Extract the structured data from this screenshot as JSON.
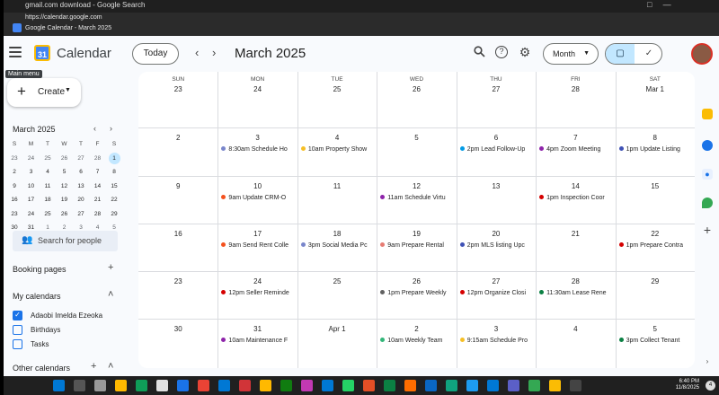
{
  "browser": {
    "tab_title": "gmail.com download - Google Search",
    "url": "https://calendar.google.com",
    "page_title": "Google Calendar - March 2025",
    "window_controls": [
      "□",
      "—"
    ]
  },
  "header": {
    "menu_tooltip": "Main menu",
    "logo_text": "31",
    "app_name": "Calendar",
    "today_label": "Today",
    "prev_label": "‹",
    "next_label": "›",
    "month_title": "March 2025",
    "view_label": "Month",
    "search_icon": "search-icon",
    "help_icon": "help-icon",
    "settings_icon": "gear-icon"
  },
  "sidebar": {
    "create_label": "Create",
    "mini_title": "March 2025",
    "mini_dow": [
      "S",
      "M",
      "T",
      "W",
      "T",
      "F",
      "S"
    ],
    "mini_weeks": [
      [
        "23",
        "24",
        "25",
        "26",
        "27",
        "28",
        "1"
      ],
      [
        "2",
        "3",
        "4",
        "5",
        "6",
        "7",
        "8"
      ],
      [
        "9",
        "10",
        "11",
        "12",
        "13",
        "14",
        "15"
      ],
      [
        "16",
        "17",
        "18",
        "19",
        "20",
        "21",
        "22"
      ],
      [
        "23",
        "24",
        "25",
        "26",
        "27",
        "28",
        "29"
      ],
      [
        "30",
        "31",
        "1",
        "2",
        "3",
        "4",
        "5"
      ]
    ],
    "mini_today": "1",
    "search_people_placeholder": "Search for people",
    "booking_pages_label": "Booking pages",
    "my_calendars_label": "My calendars",
    "calendars": [
      {
        "name": "Adaobi Imelda Ezeoka",
        "checked": true
      },
      {
        "name": "Birthdays",
        "checked": false
      },
      {
        "name": "Tasks",
        "checked": false
      }
    ],
    "other_calendars_label": "Other calendars"
  },
  "grid": {
    "weekdays": [
      "SUN",
      "MON",
      "TUE",
      "WED",
      "THU",
      "FRI",
      "SAT"
    ],
    "weeks": [
      [
        {
          "day": "23"
        },
        {
          "day": "24"
        },
        {
          "day": "25"
        },
        {
          "day": "26"
        },
        {
          "day": "27"
        },
        {
          "day": "28"
        },
        {
          "day": "Mar 1"
        }
      ],
      [
        {
          "day": "2"
        },
        {
          "day": "3",
          "event": "8:30am Schedule Ho",
          "color": "#7986cb"
        },
        {
          "day": "4",
          "event": "10am Property Show",
          "color": "#f6bf26"
        },
        {
          "day": "5"
        },
        {
          "day": "6",
          "event": "2pm Lead Follow-Up",
          "color": "#039be5"
        },
        {
          "day": "7",
          "event": "4pm Zoom Meeting",
          "color": "#8e24aa"
        },
        {
          "day": "8",
          "event": "1pm Update Listing",
          "color": "#3f51b5"
        }
      ],
      [
        {
          "day": "9"
        },
        {
          "day": "10",
          "event": "9am Update CRM-O",
          "color": "#f4511e"
        },
        {
          "day": "11"
        },
        {
          "day": "12",
          "event": "11am Schedule Virtu",
          "color": "#8e24aa"
        },
        {
          "day": "13"
        },
        {
          "day": "14",
          "event": "1pm Inspection Coor",
          "color": "#d50000"
        },
        {
          "day": "15"
        }
      ],
      [
        {
          "day": "16"
        },
        {
          "day": "17",
          "event": "9am Send Rent Colle",
          "color": "#f4511e"
        },
        {
          "day": "18",
          "event": "3pm Social Media Pc",
          "color": "#7986cb"
        },
        {
          "day": "19",
          "event": "9am Prepare Rental",
          "color": "#e67c73"
        },
        {
          "day": "20",
          "event": "2pm MLS listing Upc",
          "color": "#3f51b5"
        },
        {
          "day": "21"
        },
        {
          "day": "22",
          "event": "1pm Prepare Contra",
          "color": "#d50000"
        }
      ],
      [
        {
          "day": "23"
        },
        {
          "day": "24",
          "event": "12pm Seller Reminde",
          "color": "#d50000"
        },
        {
          "day": "25"
        },
        {
          "day": "26",
          "event": "1pm Prepare Weekly",
          "color": "#616161"
        },
        {
          "day": "27",
          "event": "12pm Organize Closi",
          "color": "#d50000"
        },
        {
          "day": "28",
          "event": "11:30am Lease Rene",
          "color": "#0b8043"
        },
        {
          "day": "29"
        }
      ],
      [
        {
          "day": "30"
        },
        {
          "day": "31",
          "event": "10am Maintenance F",
          "color": "#8e24aa"
        },
        {
          "day": "Apr 1"
        },
        {
          "day": "2",
          "event": "10am Weekly Team",
          "color": "#33b679"
        },
        {
          "day": "3",
          "event": "9:15am Schedule Pro",
          "color": "#f6bf26"
        },
        {
          "day": "4"
        },
        {
          "day": "5",
          "event": "3pm Collect Tenant",
          "color": "#0b8043"
        }
      ]
    ]
  },
  "right_rail": [
    "keep-icon",
    "tasks-icon",
    "contacts-icon",
    "maps-icon",
    "add-icon"
  ],
  "taskbar": {
    "time": "6:40 PM",
    "date": "11/8/2025",
    "notification_count": "4"
  },
  "colors": {
    "accent": "#1a73e8",
    "selected_view": "#c2e7ff",
    "grid_border": "#dadce0"
  }
}
